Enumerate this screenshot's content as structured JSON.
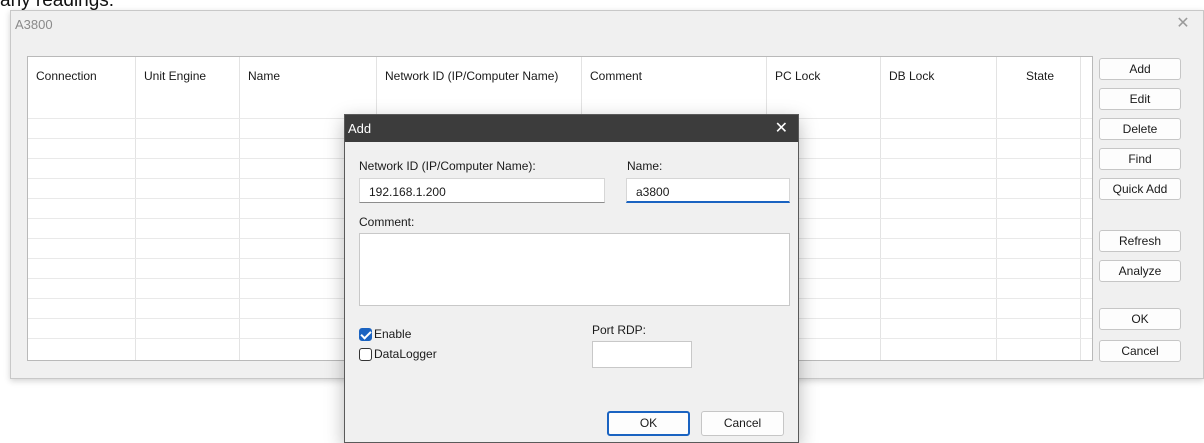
{
  "cut_text": "any readings:",
  "window": {
    "title": "A3800",
    "close_glyph": "✕"
  },
  "table": {
    "columns": [
      "Connection",
      "Unit Engine",
      "Name",
      "Network ID (IP/Computer Name)",
      "Comment",
      "PC Lock",
      "DB Lock",
      "State"
    ]
  },
  "side_buttons": {
    "add": "Add",
    "edit": "Edit",
    "delete": "Delete",
    "find": "Find",
    "quick_add": "Quick Add",
    "refresh": "Refresh",
    "analyze": "Analyze",
    "ok": "OK",
    "cancel": "Cancel"
  },
  "dialog": {
    "title": "Add",
    "close_glyph": "✕",
    "network_id_label": "Network ID (IP/Computer Name):",
    "network_id_value": "192.168.1.200",
    "name_label": "Name:",
    "name_value": "a3800",
    "comment_label": "Comment:",
    "comment_value": "",
    "enable_label": "Enable",
    "enable_checked": true,
    "datalogger_label": "DataLogger",
    "datalogger_checked": false,
    "port_rdp_label": "Port RDP:",
    "port_rdp_value": "",
    "ok": "OK",
    "cancel": "Cancel"
  },
  "colors": {
    "accent": "#1a63c1",
    "titlebar": "#3c3c3c"
  }
}
